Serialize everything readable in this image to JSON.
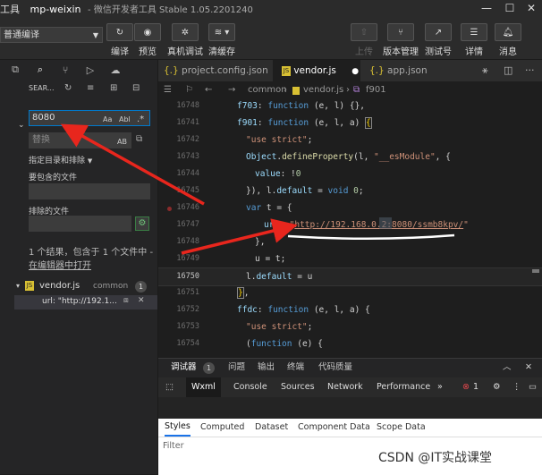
{
  "window": {
    "title_prefix": "工具",
    "app_name": "mp-weixin",
    "app_suffix": "- 微信开发者工具 Stable 1.05.2201240",
    "min": "—",
    "max": "☐"
  },
  "toolbar": {
    "compile_mode": "普通编译",
    "buttons": [
      {
        "label": "编译",
        "icon": "refresh-icon"
      },
      {
        "label": "预览",
        "icon": "eye-icon"
      },
      {
        "label": "真机调试",
        "icon": "bug-icon"
      },
      {
        "label": "清缓存",
        "icon": "layers-icon"
      },
      {
        "label": "上传",
        "icon": "upload-icon"
      },
      {
        "label": "版本管理",
        "icon": "branch-icon"
      },
      {
        "label": "测试号",
        "icon": "external-link-icon"
      },
      {
        "label": "详情",
        "icon": "details-icon"
      },
      {
        "label": "消息",
        "icon": "bell-icon"
      }
    ]
  },
  "search": {
    "header": "SEAR...",
    "query": "8080",
    "match_case": "Aa",
    "whole_word": "Abl",
    "regex": ".*",
    "replace_placeholder": "替换",
    "preserve_case": "AB",
    "scope_toggle": "指定目录和排除",
    "include_label": "要包含的文件",
    "exclude_label": "排除的文件",
    "result_text": "1 个结果，包含于 1 个文件中 - ",
    "open_in_editor": "在编辑器中打开",
    "file_name": "vendor.js",
    "file_dir": "common",
    "file_count": "1",
    "match_preview": "url: \"http://192.1...",
    "match_count": "1"
  },
  "editor": {
    "tabs": [
      {
        "label": "project.config.json"
      },
      {
        "label": "vendor.js",
        "dirty": "●"
      },
      {
        "label": "app.json"
      }
    ],
    "breadcrumb": {
      "folder": "common",
      "file": "vendor.js",
      "symbol": "f901"
    },
    "current_line": "16750",
    "url_value": "http://192.168.0.2:8080/ssmb8kpv/"
  },
  "devtools": {
    "tabs": [
      "调试器",
      "问题",
      "输出",
      "终端",
      "代码质量"
    ],
    "debugger_badge": "1",
    "panel_tabs": [
      "Wxml",
      "Console",
      "Sources",
      "Network",
      "Performance"
    ],
    "error_count": "1",
    "style_tabs": [
      "Styles",
      "Computed",
      "Dataset",
      "Component Data",
      "Scope Data"
    ],
    "filter_placeholder": "Filter"
  },
  "watermark": "CSDN @IT实战课堂",
  "colors": {
    "accent": "#007acc",
    "annotation": "#e8261d",
    "keyword": "#569cd6",
    "string": "#ce9178"
  }
}
